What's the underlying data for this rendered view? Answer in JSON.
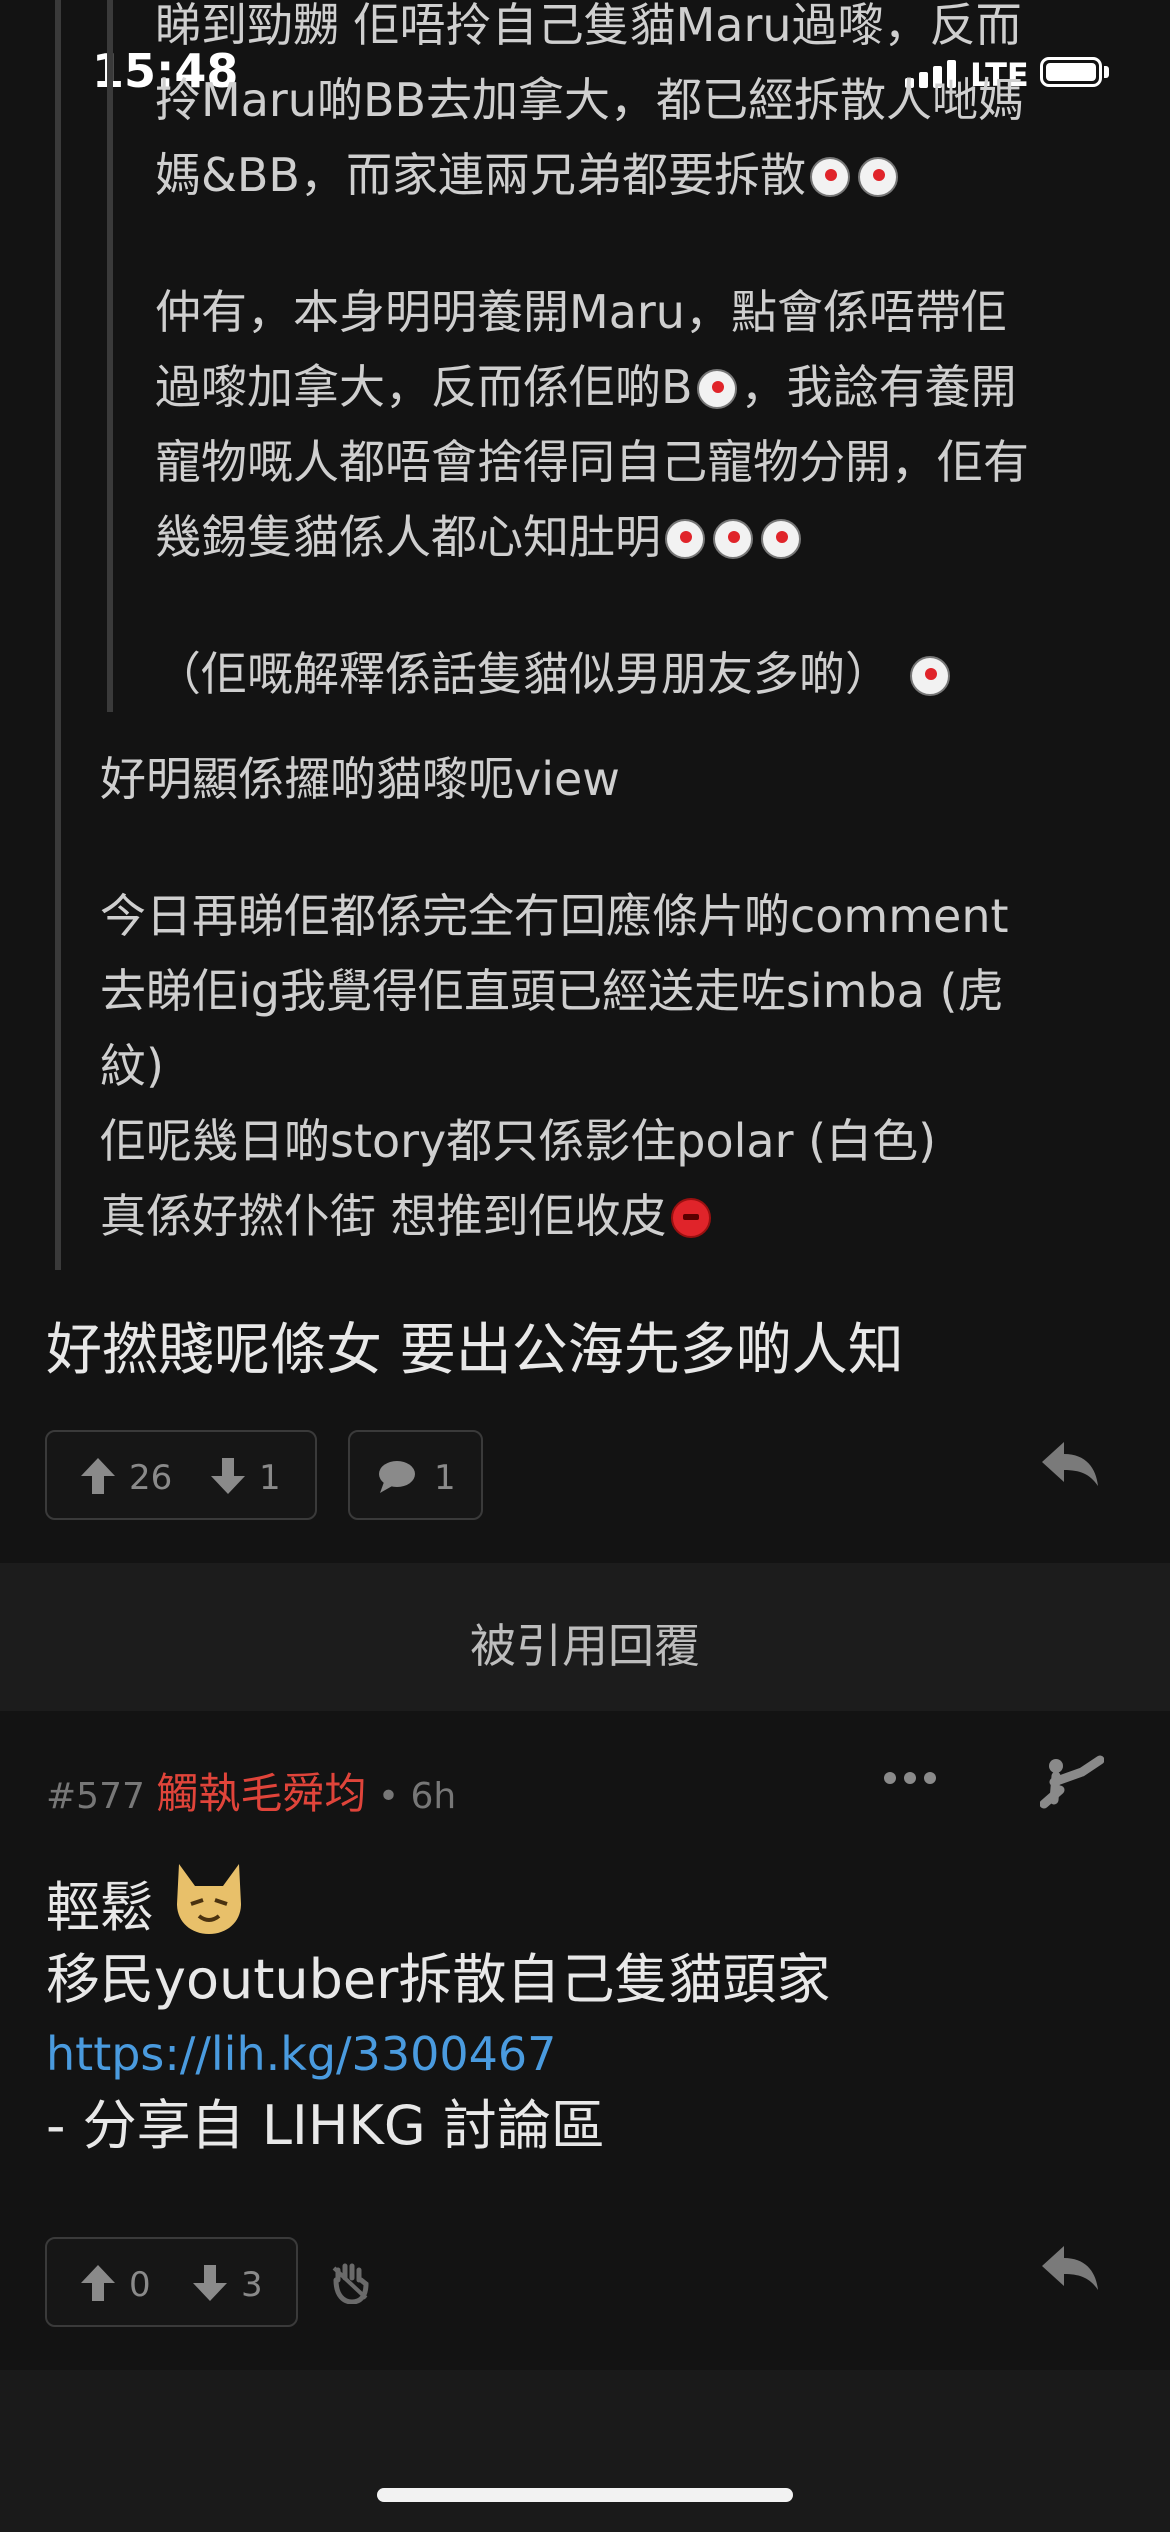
{
  "status_bar": {
    "time": "15:48",
    "network": "LTE"
  },
  "nested_quote": {
    "line1": "睇到勁嬲 佢唔拎自己隻貓Maru過嚟，反而",
    "line2": "拎Maru啲BB去加拿大，都已經拆散人哋媽",
    "line3": "媽&BB，而家連兩兄弟都要拆散",
    "p2_line1": "仲有，本身明明養開Maru，點會係唔帶佢",
    "p2_line2": "過嚟加拿大，反而係佢啲B",
    "p2_line2b": "，我諗有養開",
    "p2_line3": "寵物嘅人都唔會捨得同自己寵物分開，佢有",
    "p2_line4": "幾錫隻貓係人都心知肚明",
    "p3_line1": "（佢嘅解釋係話隻貓似男朋友多啲）"
  },
  "quote": {
    "line1": "好明顯係攞啲貓嚟呃view",
    "line2": "今日再睇佢都係完全冇回應條片啲comment",
    "line3": "去睇佢ig我覺得佢直頭已經送走咗simba (虎",
    "line4": "紋)",
    "line5": "佢呢幾日啲story都只係影住polar (白色)",
    "line6": "真係好撚仆街 想推到佢收皮"
  },
  "reply_main": {
    "text": "好撚賤呢條女 要出公海先多啲人知",
    "upvotes": "26",
    "downvotes": "1",
    "comments": "1"
  },
  "section": {
    "title": "被引用回覆"
  },
  "post": {
    "floor": "#577",
    "author": "觸執毛舜均",
    "time": "• 6h",
    "line1": "輕鬆",
    "line2": "移民youtuber拆散自己隻貓頭家",
    "link": "https://lih.kg/3300467",
    "line4": "- 分享自 LIHKG 討論區",
    "upvotes": "0",
    "downvotes": "3"
  },
  "colors": {
    "author": "#e0443a",
    "link": "#4a9bdf",
    "background": "#131313"
  },
  "icons": [
    "signal-icon",
    "battery-icon",
    "upvote-icon",
    "downvote-icon",
    "comment-icon",
    "reply-icon",
    "more-icon",
    "share-icon",
    "block-icon"
  ]
}
